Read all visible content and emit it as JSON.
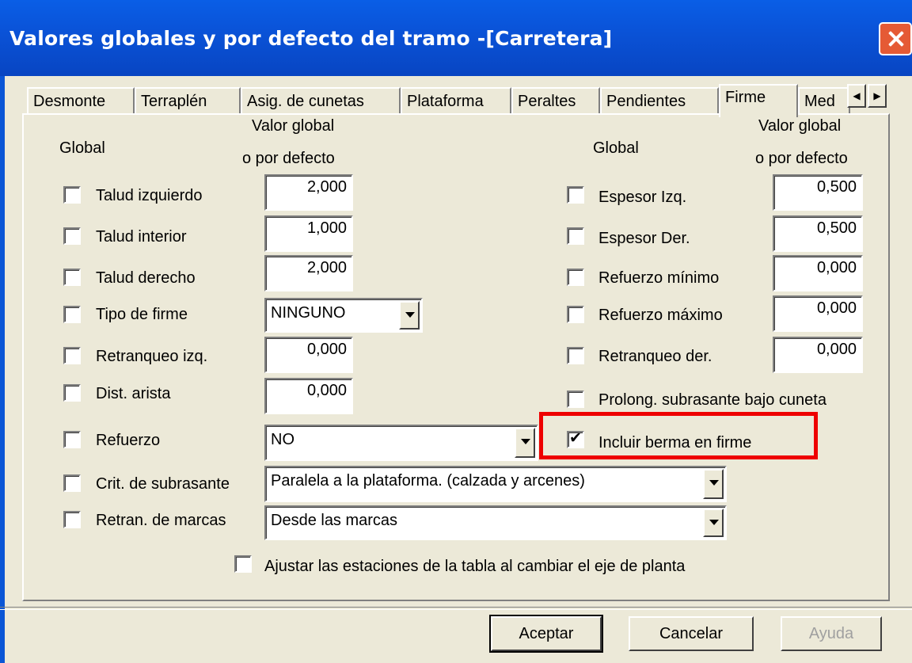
{
  "window": {
    "title": "Valores globales y por defecto del tramo -[Carretera]"
  },
  "tabs": [
    {
      "label": "Desmonte"
    },
    {
      "label": "Terraplén"
    },
    {
      "label": "Asig. de cunetas"
    },
    {
      "label": "Plataforma"
    },
    {
      "label": "Peraltes"
    },
    {
      "label": "Pendientes"
    },
    {
      "label": "Firme",
      "active": true
    },
    {
      "label": "Med"
    }
  ],
  "headers": {
    "left_global": "Global",
    "left_value_1": "Valor global",
    "left_value_2": "o por defecto",
    "right_global": "Global",
    "right_value_1": "Valor global",
    "right_value_2": "o por defecto"
  },
  "left_rows": [
    {
      "label": "Talud izquierdo",
      "value": "2,000",
      "checked": false
    },
    {
      "label": "Talud interior",
      "value": "1,000",
      "checked": false
    },
    {
      "label": "Talud derecho",
      "value": "2,000",
      "checked": false
    },
    {
      "label": "Tipo de firme",
      "value": "NINGUNO",
      "checked": false
    },
    {
      "label": "Retranqueo izq.",
      "value": "0,000",
      "checked": false
    },
    {
      "label": "Dist. arista",
      "value": "0,000",
      "checked": false
    },
    {
      "label": "Refuerzo",
      "value": "NO",
      "checked": false
    },
    {
      "label": "Crit. de subrasante",
      "value": "Paralela a la plataforma. (calzada y arcenes)",
      "checked": false
    },
    {
      "label": "Retran. de marcas",
      "value": "Desde las marcas",
      "checked": false
    }
  ],
  "right_rows": [
    {
      "label": "Espesor Izq.",
      "value": "0,500",
      "checked": false
    },
    {
      "label": "Espesor Der.",
      "value": "0,500",
      "checked": false
    },
    {
      "label": "Refuerzo mínimo",
      "value": "0,000",
      "checked": false
    },
    {
      "label": "Refuerzo máximo",
      "value": "0,000",
      "checked": false
    },
    {
      "label": "Retranqueo der.",
      "value": "0,000",
      "checked": false
    },
    {
      "label": "Prolong. subrasante bajo cuneta",
      "checked": false
    },
    {
      "label": "Incluir berma en firme",
      "checked": true
    }
  ],
  "bottom_option": {
    "label": "Ajustar las estaciones de la tabla al cambiar el eje de planta",
    "checked": false
  },
  "buttons": {
    "ok": "Aceptar",
    "cancel": "Cancelar",
    "help": "Ayuda"
  },
  "colors": {
    "title_bar": "#0a53d8",
    "face": "#ece9d8",
    "highlight": "#ee0000"
  }
}
